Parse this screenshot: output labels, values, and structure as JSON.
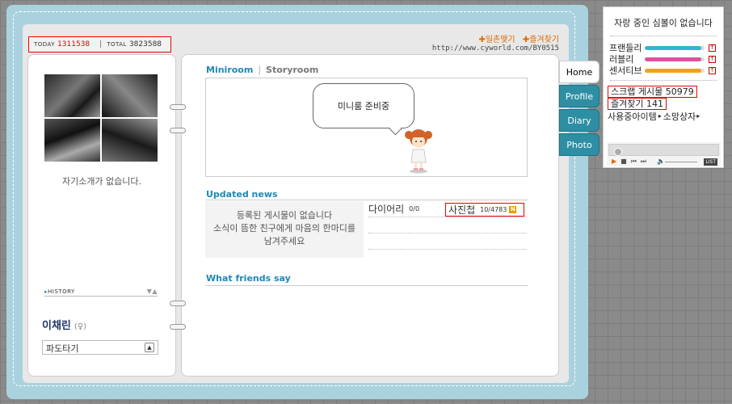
{
  "counter": {
    "today_label": "TODAY",
    "today_value": "1311538",
    "total_label": "TOTAL",
    "total_value": "3823588"
  },
  "top_links": {
    "ilchon": "✚일촌맺기",
    "favorite": "✚즐겨찾기",
    "url": "http://www.cyworld.com/BY0515"
  },
  "profile": {
    "intro": "자기소개가 없습니다.",
    "history_label": "HISTORY",
    "name": "이채린",
    "gender": "(♀)",
    "wave_label": "파도타기"
  },
  "home": {
    "tab_active": "Miniroom",
    "tab_divider": "|",
    "tab_inactive": "Storyroom",
    "bubble_text": "미니룸 준비중",
    "updated_news_title": "Updated news",
    "no_posts_line1": "등록된 게시물이 없습니다",
    "no_posts_line2": "소식이 뜸한 친구에게 마음의 한마디를",
    "no_posts_line3": "남겨주세요",
    "diary_label": "다이어리",
    "diary_count": "0/0",
    "photo_label": "사진첩",
    "photo_count": "10/4783",
    "new_badge": "N",
    "friends_title": "What friends say"
  },
  "menu_tabs": [
    {
      "label": "Home",
      "active": true
    },
    {
      "label": "Profile",
      "active": false
    },
    {
      "label": "Diary",
      "active": false
    },
    {
      "label": "Photo",
      "active": false
    }
  ],
  "side_panel": {
    "title": "자랑 중인 심볼이 없습니다",
    "meters": [
      {
        "label": "프랜들리",
        "level": 0.95,
        "color": "#35b6cf"
      },
      {
        "label": "러블리",
        "level": 0.95,
        "color": "#e24fa0"
      },
      {
        "label": "센서티브",
        "level": 0.95,
        "color": "#f0a21c"
      }
    ],
    "up_icon": "↑",
    "scrap_label": "스크랩 게시물 50979",
    "favorite_label": "즐겨찾기 141",
    "items_label": "사용중아이템",
    "shopping_label": "소망상자",
    "player_list": "LIST"
  }
}
